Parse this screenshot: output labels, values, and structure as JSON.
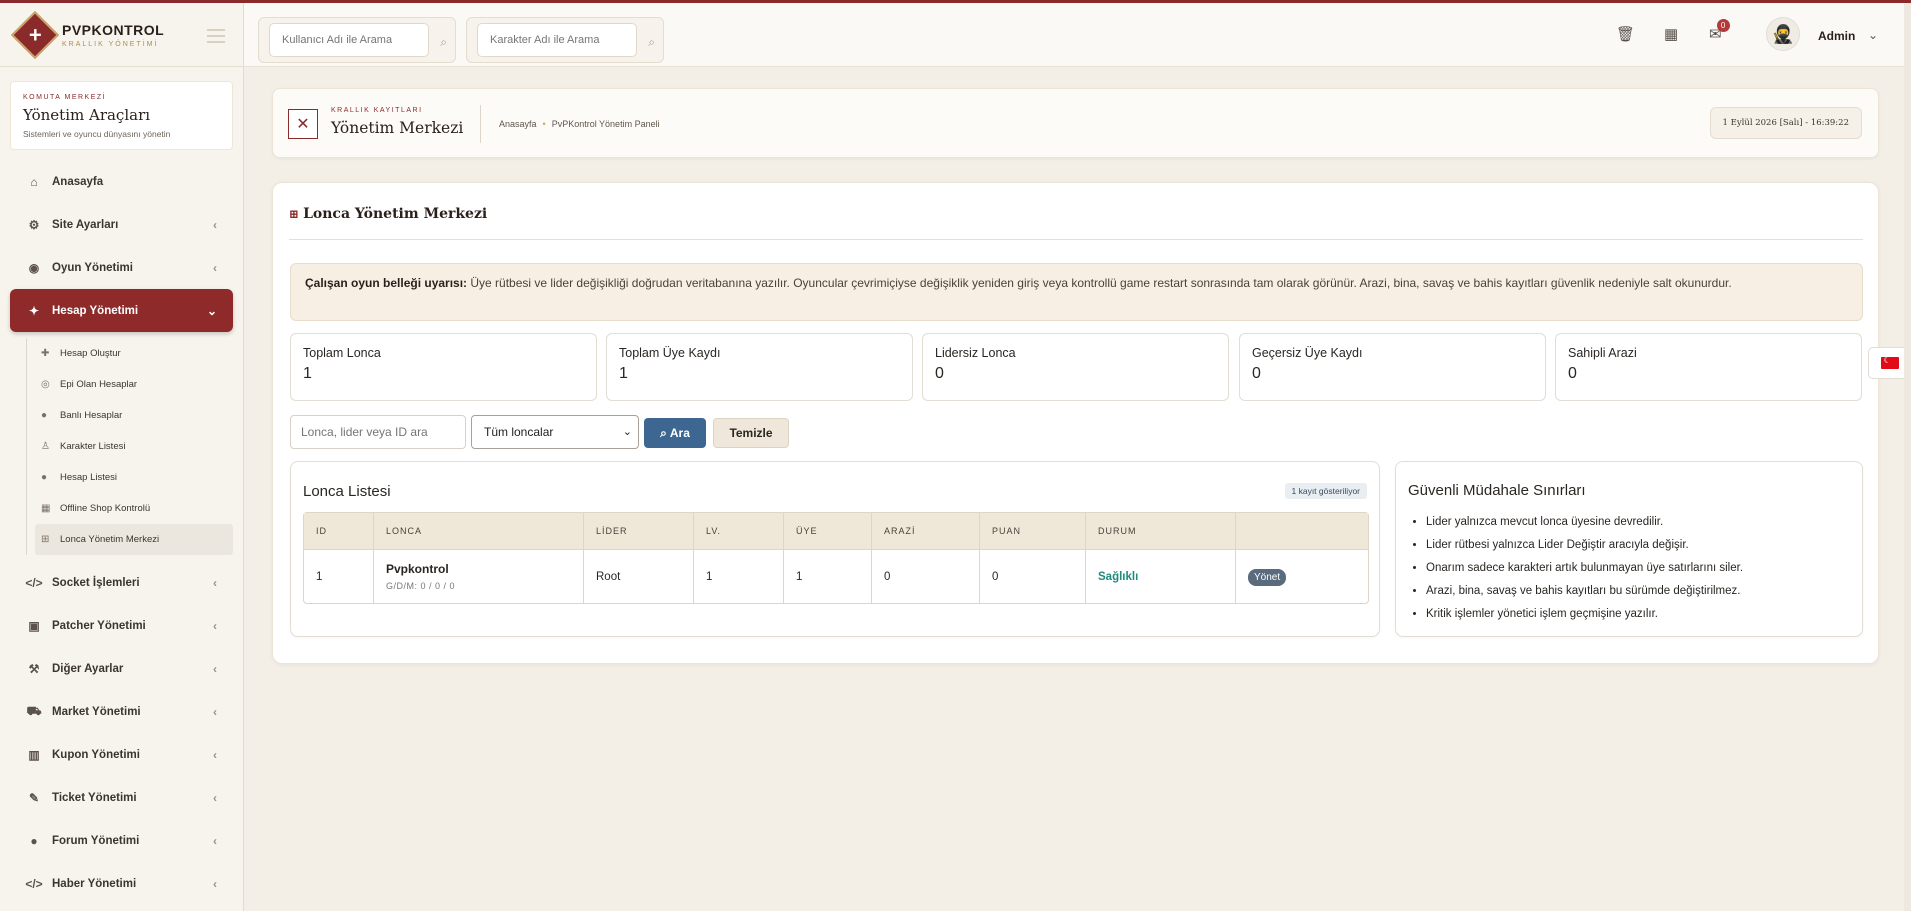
{
  "brand": {
    "title": "PVPKONTROL",
    "subtitle": "KRALLIK YÖNETİMİ"
  },
  "sidebar": {
    "section_kicker": "KOMUTA MERKEZİ",
    "section_title": "Yönetim Araçları",
    "section_sub": "Sistemleri ve oyuncu dünyasını yönetin",
    "items_top": [
      {
        "label": "Anasayfa",
        "icon": "home-icon"
      },
      {
        "label": "Site Ayarları",
        "icon": "gear-icon"
      },
      {
        "label": "Oyun Yönetimi",
        "icon": "gamepad-icon"
      },
      {
        "label": "Hesap Yönetimi",
        "icon": "users-icon"
      }
    ],
    "sub_items": [
      {
        "label": "Hesap Oluştur",
        "icon": "plus-icon"
      },
      {
        "label": "Epi Olan Hesaplar",
        "icon": "coins-icon"
      },
      {
        "label": "Banlı Hesaplar",
        "icon": "user-ban-icon"
      },
      {
        "label": "Karakter Listesi",
        "icon": "person-icon"
      },
      {
        "label": "Hesap Listesi",
        "icon": "users-icon"
      },
      {
        "label": "Offline Shop Kontrolü",
        "icon": "shop-icon"
      },
      {
        "label": "Lonca Yönetim Merkezi",
        "icon": "sitemap-icon"
      }
    ],
    "items_bottom": [
      {
        "label": "Socket İşlemleri",
        "icon": "code-icon"
      },
      {
        "label": "Patcher Yönetimi",
        "icon": "box-icon"
      },
      {
        "label": "Diğer Ayarlar",
        "icon": "wrench-icon"
      },
      {
        "label": "Market Yönetimi",
        "icon": "cart-icon"
      },
      {
        "label": "Kupon Yönetimi",
        "icon": "barcode-icon"
      },
      {
        "label": "Ticket Yönetimi",
        "icon": "ticket-icon"
      },
      {
        "label": "Forum Yönetimi",
        "icon": "comments-icon"
      },
      {
        "label": "Haber Yönetimi",
        "icon": "code-icon"
      }
    ]
  },
  "header": {
    "search_user_placeholder": "Kullanıcı Adı ile Arama",
    "search_char_placeholder": "Karakter Adı ile Arama",
    "notification_count": "0",
    "user_name": "Admin"
  },
  "pagehead": {
    "kicker": "KRALLIK KAYITLARI",
    "title": "Yönetim Merkezi",
    "breadcrumb_home": "Anasayfa",
    "breadcrumb_current": "PvPKontrol Yönetim Paneli",
    "datetime": "1 Eylül 2026 [Salı] - 16:39:22"
  },
  "panel": {
    "title": "Lonca Yönetim Merkezi",
    "alert_bold": "Çalışan oyun belleği uyarısı:",
    "alert_text": " Üye rütbesi ve lider değişikliği doğrudan veritabanına yazılır. Oyuncular çevrimiçiyse değişiklik yeniden giriş veya kontrollü game restart sonrasında tam olarak görünür. Arazi, bina, savaş ve bahis kayıtları güvenlik nedeniyle salt okunurdur.",
    "stats": [
      {
        "label": "Toplam Lonca",
        "value": "1"
      },
      {
        "label": "Toplam Üye Kaydı",
        "value": "1"
      },
      {
        "label": "Lidersiz Lonca",
        "value": "0"
      },
      {
        "label": "Geçersiz Üye Kaydı",
        "value": "0"
      },
      {
        "label": "Sahipli Arazi",
        "value": "0"
      }
    ],
    "filter_placeholder": "Lonca, lider veya ID ara",
    "filter_select": "Tüm loncalar",
    "search_button": "Ara",
    "clear_button": "Temizle"
  },
  "guild_list": {
    "title": "Lonca Listesi",
    "badge": "1 kayıt gösteriliyor",
    "columns": [
      "ID",
      "LONCA",
      "LİDER",
      "LV.",
      "ÜYE",
      "ARAZİ",
      "PUAN",
      "DURUM",
      ""
    ],
    "rows": [
      {
        "id": "1",
        "name": "Pvpkontrol",
        "sub": "G/D/M: 0 / 0 / 0",
        "leader": "Root",
        "level": "1",
        "members": "1",
        "land": "0",
        "points": "0",
        "status": "Sağlıklı",
        "action": "Yönet"
      }
    ]
  },
  "safe_limits": {
    "title": "Güvenli Müdahale Sınırları",
    "items": [
      "Lider yalnızca mevcut lonca üyesine devredilir.",
      "Lider rütbesi yalnızca Lider Değiştir aracıyla değişir.",
      "Onarım sadece karakteri artık bulunmayan üye satırlarını siler.",
      "Arazi, bina, savaş ve bahis kayıtları bu sürümde değiştirilmez.",
      "Kritik işlemler yönetici işlem geçmişine yazılır."
    ]
  }
}
